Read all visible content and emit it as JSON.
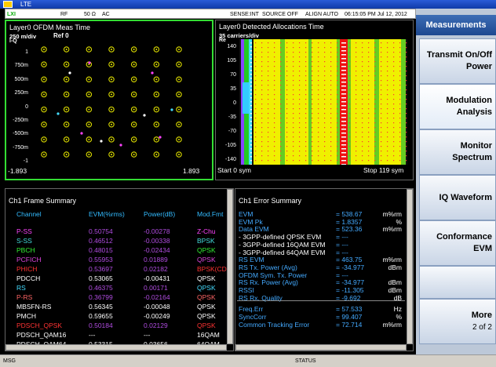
{
  "window": {
    "title": "LTE"
  },
  "statusbar": {
    "rf": "RF",
    "impedance": "50 Ω",
    "coupling": "AC",
    "sense": "SENSE:INT",
    "source": "SOURCE OFF",
    "align": "ALIGN AUTO",
    "datetime": "06:15:05 PM Jul 12, 2012"
  },
  "panel": {
    "header": "Measurements",
    "softkeys": [
      {
        "label": "Transmit On/Off",
        "sub": "Power"
      },
      {
        "label": "Modulation",
        "sub": "Analysis"
      },
      {
        "label": "Monitor",
        "sub": "Spectrum"
      },
      {
        "label": "IQ Waveform",
        "sub": ""
      },
      {
        "label": "Conformance",
        "sub": "EVM"
      },
      {
        "label": "More",
        "sub": "2 of 2"
      }
    ]
  },
  "constellation": {
    "title": "Layer0 OFDM Meas Time",
    "scale": "250 m/div",
    "ref": "Ref 0",
    "axis_label": "I-Q",
    "y_ticks": [
      "1",
      "750m",
      "500m",
      "250m",
      "0",
      "-250m",
      "-500m",
      "-750m",
      "-1"
    ],
    "x_min": "-1.893",
    "x_max": "1.893"
  },
  "allocations": {
    "title": "Layer0 Detected Allocations Time",
    "scale": "35 carriers/div",
    "axis_label": "Re",
    "y_ticks": [
      "140",
      "105",
      "70",
      "35",
      "0",
      "-35",
      "-70",
      "-105",
      "-140"
    ],
    "x_start": "Start 0 sym",
    "x_stop": "Stop 119 sym"
  },
  "frame_summary": {
    "title": "Ch1 Frame Summary",
    "columns": [
      "Channel",
      "EVM(%rms)",
      "Power(dB)",
      "Mod.Fmt"
    ],
    "rows": [
      {
        "channel": "P-SS",
        "evm": "0.50754",
        "power": "-0.00278",
        "mod": "Z-Chu",
        "color": "#ff44ff"
      },
      {
        "channel": "S-SS",
        "evm": "0.46512",
        "power": "-0.00338",
        "mod": "BPSK",
        "color": "#44dddd"
      },
      {
        "channel": "PBCH",
        "evm": "0.48015",
        "power": "-0.02434",
        "mod": "QPSK",
        "color": "#33ee33"
      },
      {
        "channel": "PCFICH",
        "evm": "0.55953",
        "power": "0.01889",
        "mod": "QPSK",
        "color": "#dd44dd"
      },
      {
        "channel": "PHICH",
        "evm": "0.53697",
        "power": "0.02182",
        "mod": "BPSK(CD",
        "color": "#ff3333"
      },
      {
        "channel": "PDCCH",
        "evm": "0.53065",
        "power": "-0.00431",
        "mod": "QPSK",
        "color": "#ffffff"
      },
      {
        "channel": "RS",
        "evm": "0.46375",
        "power": "0.00171",
        "mod": "QPSK",
        "color": "#44ddff"
      },
      {
        "channel": "P-RS",
        "evm": "0.36799",
        "power": "-0.02164",
        "mod": "QPSK",
        "color": "#ff6666"
      },
      {
        "channel": "MBSFN-RS",
        "evm": "0.56345",
        "power": "-0.00048",
        "mod": "QPSK",
        "color": "#ffffff"
      },
      {
        "channel": "PMCH",
        "evm": "0.59655",
        "power": "-0.00249",
        "mod": "QPSK",
        "color": "#ffffff"
      },
      {
        "channel": "PDSCH_QPSK",
        "evm": "0.50184",
        "power": "0.02129",
        "mod": "QPSK",
        "color": "#ff3333"
      },
      {
        "channel": "PDSCH_QAM16",
        "evm": "---",
        "power": "---",
        "mod": "16QAM",
        "color": "#ffffff"
      },
      {
        "channel": "PDSCH_QAM64",
        "evm": "0.53315",
        "power": "0.03656",
        "mod": "64QAM",
        "color": "#ffffff"
      }
    ]
  },
  "error_summary": {
    "title": "Ch1 Error Summary",
    "rows": [
      {
        "name": "EVM",
        "value": "= 538.67",
        "unit": "m%rm"
      },
      {
        "name": "EVM Pk",
        "value": "= 1.8357",
        "unit": "%"
      },
      {
        "name": "Data EVM",
        "value": "= 523.36",
        "unit": "m%rm"
      },
      {
        "name": "- 3GPP-defined QPSK EVM",
        "value": "= ---",
        "unit": ""
      },
      {
        "name": "- 3GPP-defined 16QAM EVM",
        "value": "= ---",
        "unit": ""
      },
      {
        "name": "- 3GPP-defined 64QAM EVM",
        "value": "= ---",
        "unit": ""
      },
      {
        "name": "RS EVM",
        "value": "= 463.75",
        "unit": "m%rm"
      },
      {
        "name": "RS Tx. Power (Avg)",
        "value": "= -34.977",
        "unit": "dBm"
      },
      {
        "name": "OFDM Sym. Tx. Power",
        "value": "= ---",
        "unit": ""
      },
      {
        "name": "RS Rx. Power (Avg)",
        "value": "= -34.977",
        "unit": "dBm"
      },
      {
        "name": "RSSI",
        "value": "= -11.305",
        "unit": "dBm"
      },
      {
        "name": "RS Rx. Quality",
        "value": "= -9.692",
        "unit": "dB"
      },
      {
        "name": "Freq.Err",
        "value": "= 57.533",
        "unit": "Hz"
      },
      {
        "name": "SyncCorr",
        "value": "= 99.407",
        "unit": "%"
      },
      {
        "name": "Common Tracking Error",
        "value": "= 72.714",
        "unit": "m%rm"
      }
    ]
  },
  "bottom": {
    "msg": "MSG",
    "status": "STATUS"
  },
  "colors": {
    "frame_border": "#33dd33",
    "constellation_point": "#dddd00",
    "allocation_yellow": "#f0f000",
    "allocation_green": "#66cc22",
    "allocation_red": "#ee1111"
  }
}
